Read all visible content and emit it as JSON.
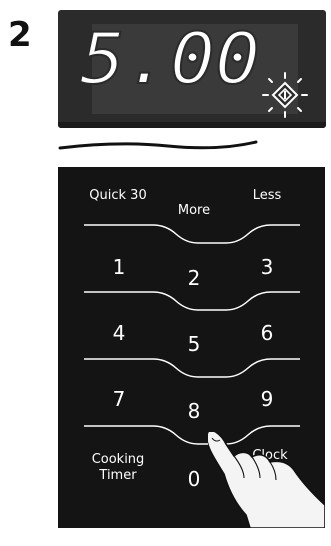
{
  "step": {
    "number": "2"
  },
  "display": {
    "readout": "5.00",
    "start_icon": "start-button-diamond-icon"
  },
  "keypad": {
    "row1": {
      "left": "Quick 30",
      "center": "More",
      "right": "Less"
    },
    "row2": {
      "left": "1",
      "center": "2",
      "right": "3"
    },
    "row3": {
      "left": "4",
      "center": "5",
      "right": "6"
    },
    "row4": {
      "left": "7",
      "center": "8",
      "right": "9"
    },
    "row5": {
      "left_line1": "Cooking",
      "left_line2": "Timer",
      "center": "0",
      "right": "Clock"
    }
  },
  "colors": {
    "panel": "#141414",
    "display_bezel": "#2b2b2b",
    "display_screen": "#3a3a3a",
    "key_text": "#ffffff",
    "step_number": "#111111"
  }
}
